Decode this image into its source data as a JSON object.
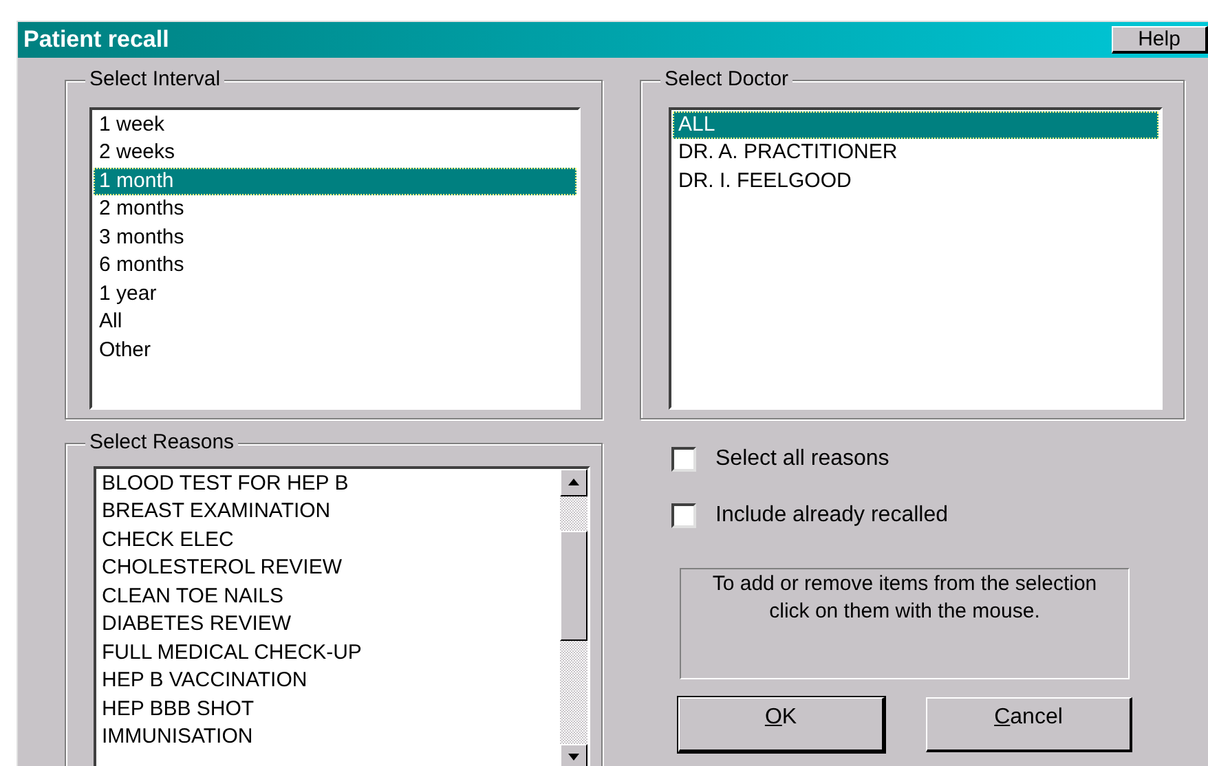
{
  "window": {
    "title": "Patient recall",
    "help_button": "Help"
  },
  "interval": {
    "title": "Select Interval",
    "items": [
      {
        "label": "1 week",
        "selected": false
      },
      {
        "label": "2 weeks",
        "selected": false
      },
      {
        "label": "1 month",
        "selected": true
      },
      {
        "label": "2 months",
        "selected": false
      },
      {
        "label": "3 months",
        "selected": false
      },
      {
        "label": "6 months",
        "selected": false
      },
      {
        "label": "1 year",
        "selected": false
      },
      {
        "label": "All",
        "selected": false
      },
      {
        "label": "Other",
        "selected": false
      }
    ]
  },
  "doctor": {
    "title": "Select Doctor",
    "items": [
      {
        "label": "ALL",
        "selected": true
      },
      {
        "label": "DR. A. PRACTITIONER",
        "selected": false
      },
      {
        "label": "DR. I. FEELGOOD",
        "selected": false
      }
    ]
  },
  "reasons": {
    "title": "Select Reasons",
    "items": [
      {
        "label": "BLOOD TEST FOR HEP B",
        "selected": false
      },
      {
        "label": "BREAST EXAMINATION",
        "selected": false
      },
      {
        "label": "CHECK ELEC",
        "selected": false
      },
      {
        "label": "CHOLESTEROL REVIEW",
        "selected": false
      },
      {
        "label": "CLEAN TOE NAILS",
        "selected": false
      },
      {
        "label": "DIABETES REVIEW",
        "selected": false
      },
      {
        "label": "FULL MEDICAL CHECK-UP",
        "selected": false
      },
      {
        "label": "HEP B VACCINATION",
        "selected": false
      },
      {
        "label": "HEP BBB SHOT",
        "selected": false
      },
      {
        "label": "IMMUNISATION",
        "selected": false
      }
    ]
  },
  "options": [
    {
      "label": "Select all reasons",
      "checked": false
    },
    {
      "label": "Include already recalled",
      "checked": false
    }
  ],
  "hint": "To add or remove items from the selection click on them with the mouse.",
  "buttons": [
    "OK",
    "Cancel"
  ]
}
